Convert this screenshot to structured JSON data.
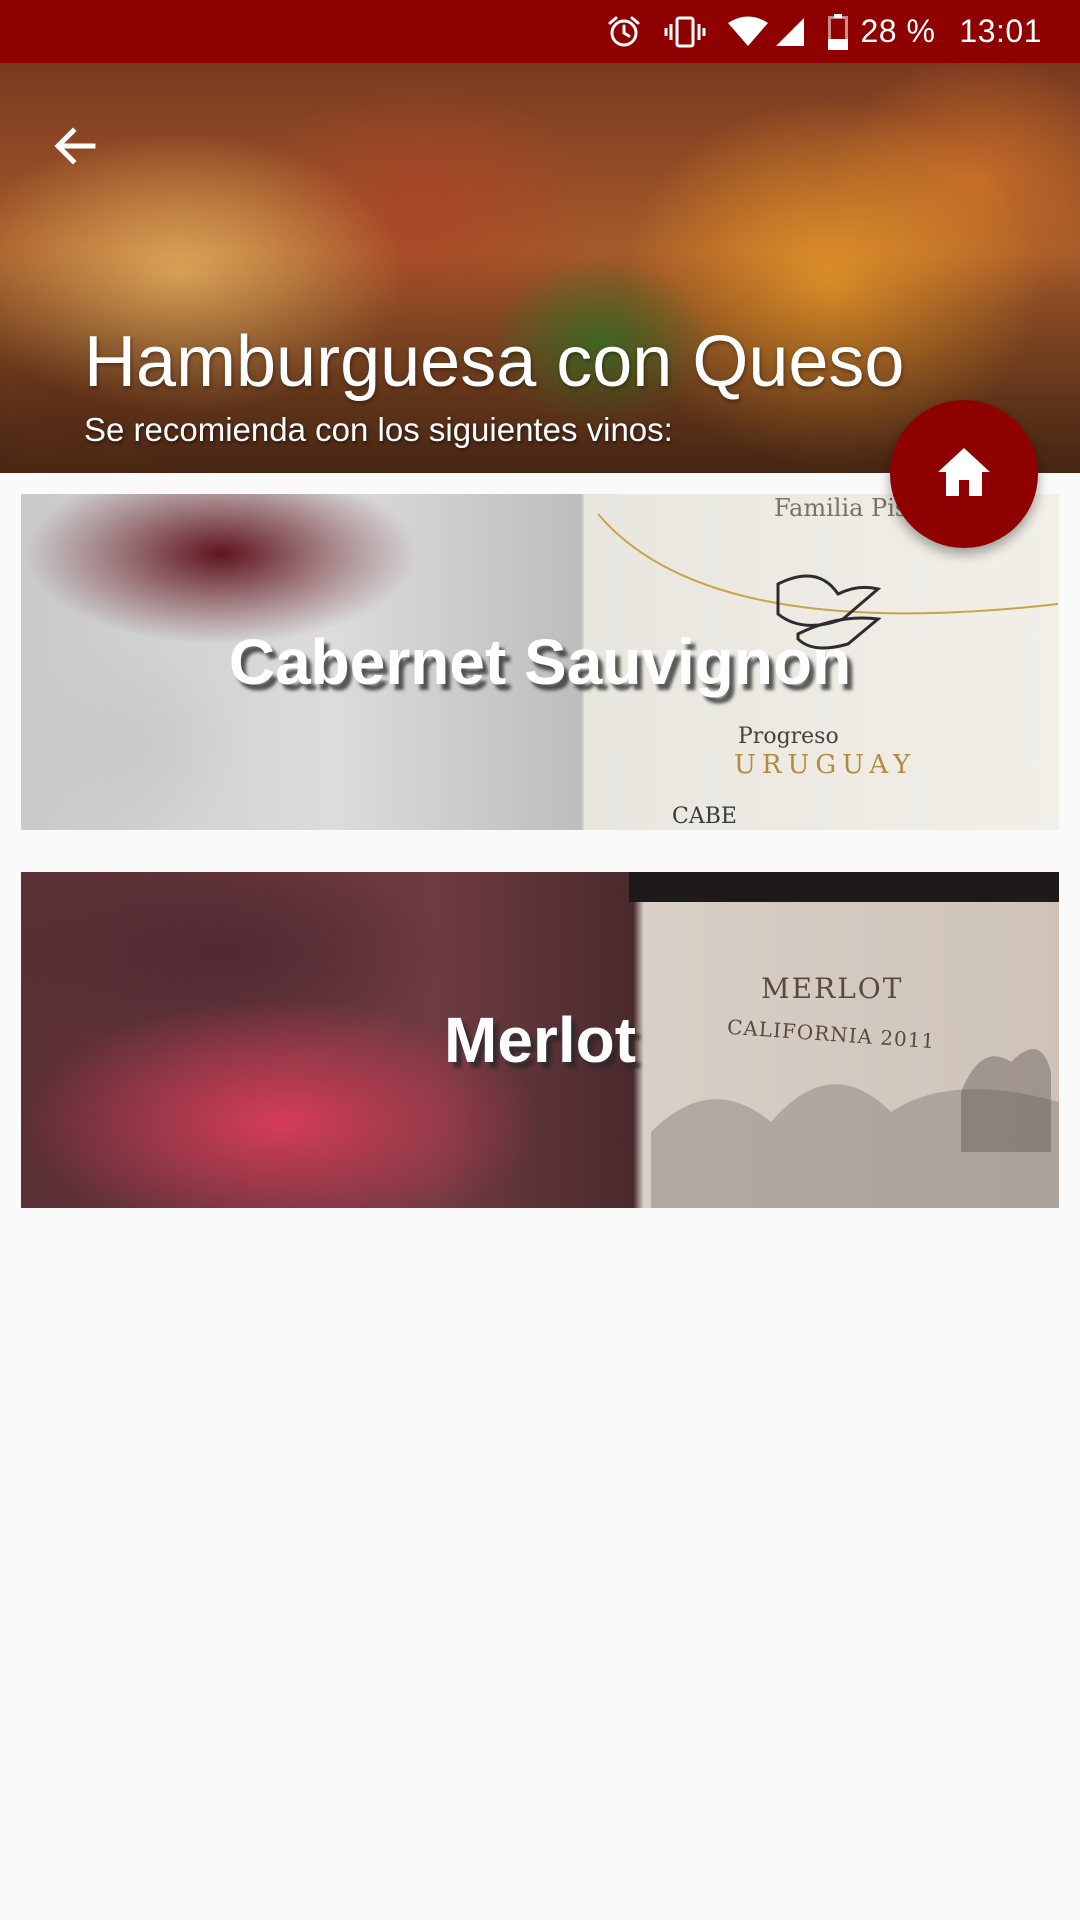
{
  "status_bar": {
    "battery": "28 %",
    "time": "13:01",
    "icons": [
      "alarm-icon",
      "vibrate-icon",
      "wifi-icon",
      "signal-icon",
      "battery-icon"
    ]
  },
  "header": {
    "back_icon": "arrow-back-icon",
    "title": "Hamburguesa con Queso",
    "subtitle": "Se recomienda con los siguientes vinos:"
  },
  "fab": {
    "icon": "home-icon",
    "color": "#8f0000"
  },
  "wines": [
    {
      "name": "Cabernet Sauvignon",
      "label_lines": [
        "Familia Pisano",
        "Progreso",
        "URUGUAY",
        "CABE"
      ]
    },
    {
      "name": "Merlot",
      "label_lines": [
        "MERLOT",
        "CALIFORNIA 2011"
      ]
    }
  ],
  "theme": {
    "primary": "#8f0000",
    "background": "#fafafa"
  }
}
